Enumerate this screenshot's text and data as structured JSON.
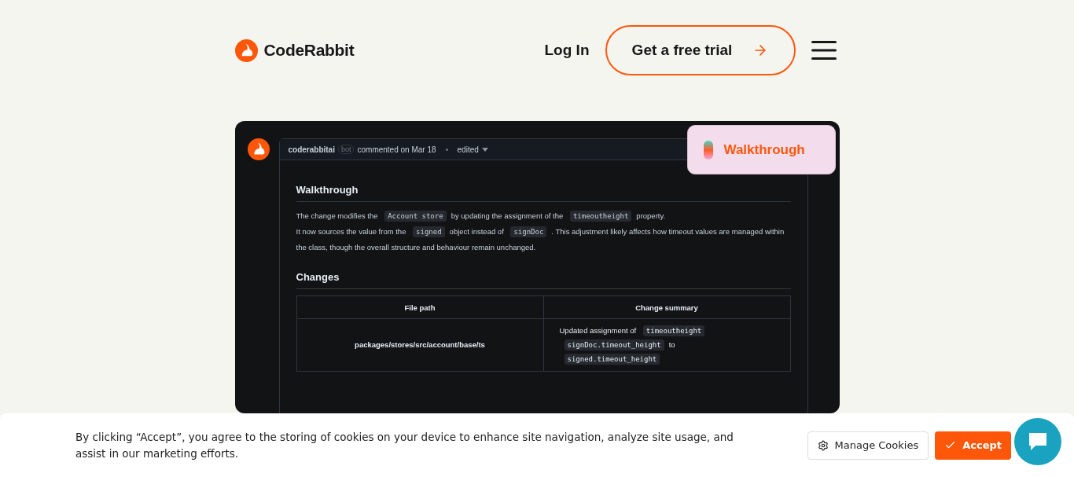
{
  "header": {
    "logo": "CodeRabbit",
    "login": "Log In",
    "cta": "Get a free trial"
  },
  "comment": {
    "author": "coderabbitai",
    "badge": "bot",
    "meta": "commented on Mar 18",
    "edited": "edited",
    "floating_label": "Walkthrough",
    "sections": [
      {
        "title": "Walkthrough",
        "paragraphs": [
          [
            {
              "kind": "text",
              "text": "The change modifies the"
            },
            {
              "kind": "code",
              "text": "Account store"
            },
            {
              "kind": "text",
              "text": "by updating the assignment of the"
            },
            {
              "kind": "code",
              "text": "timeoutheight"
            },
            {
              "kind": "text",
              "text": "property."
            }
          ],
          [
            {
              "kind": "text",
              "text": "It now sources the value from the"
            },
            {
              "kind": "code",
              "text": "signed"
            },
            {
              "kind": "text",
              "text": "object instead of"
            },
            {
              "kind": "code",
              "text": "signDoc"
            },
            {
              "kind": "text",
              "text": ". This adjustment likely affects how timeout values are managed within the class, though the overall structure and behaviour remain unchanged."
            }
          ]
        ]
      },
      {
        "title": "Changes"
      }
    ],
    "table": {
      "columns": [
        "File path",
        "Change summary"
      ],
      "rows": [
        {
          "file": "packages/stores/src/account/base/ts",
          "summary": [
            {
              "kind": "text",
              "text": "Updated assignment of"
            },
            {
              "kind": "code",
              "text": "timeoutheight"
            },
            {
              "kind": "break"
            },
            {
              "kind": "code",
              "text": "signDoc.timeout_height"
            },
            {
              "kind": "text",
              "text": "to"
            },
            {
              "kind": "code",
              "text": "signed.timeout_height"
            }
          ]
        }
      ]
    }
  },
  "cookie_banner": {
    "text": "By clicking “Accept”, you agree to the storing of cookies on your device to enhance site navigation, analyze site usage, and assist in our marketing efforts.",
    "manage": "Manage Cookies",
    "accept": "Accept"
  }
}
